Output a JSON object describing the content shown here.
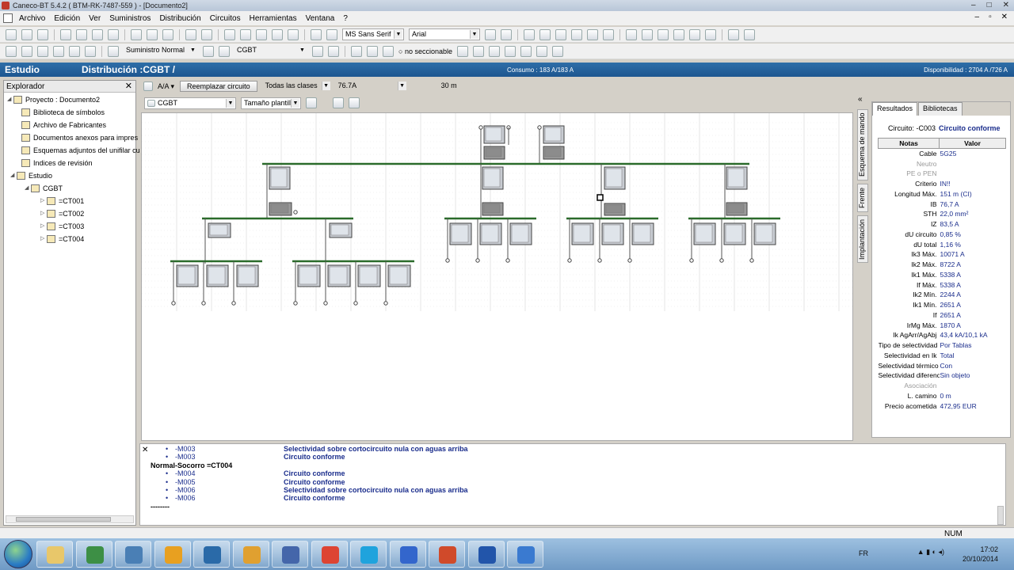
{
  "window": {
    "title": "Caneco-BT 5.4.2 ( BTM-RK-7487-559 ) - [Documento2]"
  },
  "menu": [
    "Archivo",
    "Edición",
    "Ver",
    "Suministros",
    "Distribución",
    "Circuitos",
    "Herramientas",
    "Ventana",
    "?"
  ],
  "toolbar": {
    "font_main": "MS Sans Serif",
    "font_secondary": "Arial",
    "supply_mode": "Suministro Normal",
    "board": "CGBT",
    "sectioning": "no seccionable"
  },
  "header": {
    "left": "Estudio",
    "title": "Distribución :CGBT /",
    "consumption": "Consumo : 183 A/183 A",
    "availability": "Disponibilidad : 2704 A /726 A"
  },
  "explorer": {
    "title": "Explorador",
    "items": [
      {
        "label": "Proyecto : Documento2"
      },
      {
        "label": "Biblioteca de símbolos"
      },
      {
        "label": "Archivo de Fabricantes"
      },
      {
        "label": "Documentos anexos para impres"
      },
      {
        "label": "Esquemas adjuntos del unifilar cu"
      },
      {
        "label": "Indices de revisión"
      },
      {
        "label": "Estudio"
      },
      {
        "label": "CGBT"
      },
      {
        "label": "=CT001"
      },
      {
        "label": "=CT002"
      },
      {
        "label": "=CT003"
      },
      {
        "label": "=CT004"
      }
    ]
  },
  "subbar": {
    "aa": "A/A",
    "replace_button": "Reemplazar circuito",
    "classes": "Todas las clases",
    "current": "76.7A",
    "length": "30 m",
    "view_board": "CGBT",
    "template_size": "Tamaño plantill"
  },
  "side_tabs": [
    "Esquema de mando",
    "Frente",
    "Implantación"
  ],
  "results": {
    "tabs": [
      "Resultados",
      "Bibliotecas"
    ],
    "circuit_label": "Circuito: -C003",
    "circuit_status": "Circuito conforme",
    "col_notes": "Notas",
    "col_value": "Valor",
    "rows": [
      {
        "k": "Cable",
        "v": "5G25"
      },
      {
        "k": "Neutro",
        "v": ""
      },
      {
        "k": "PE o PEN",
        "v": ""
      },
      {
        "k": "Criterio",
        "v": "IN!!"
      },
      {
        "k": "Longitud Máx.",
        "v": "151 m (CI)"
      },
      {
        "k": "IB",
        "v": "76,7 A"
      },
      {
        "k": "STH",
        "v": "22,0 mm²"
      },
      {
        "k": "IZ",
        "v": "83,5 A"
      },
      {
        "k": "dU circuito",
        "v": "0,85 %"
      },
      {
        "k": "dU total",
        "v": "1,16 %"
      },
      {
        "k": "Ik3 Máx.",
        "v": "10071 A"
      },
      {
        "k": "Ik2 Máx.",
        "v": "8722 A"
      },
      {
        "k": "Ik1 Máx.",
        "v": "5338 A"
      },
      {
        "k": "If Máx.",
        "v": "5338 A"
      },
      {
        "k": "Ik2 Mín.",
        "v": "2244 A"
      },
      {
        "k": "Ik1 Mín.",
        "v": "2651 A"
      },
      {
        "k": "If",
        "v": "2651 A"
      },
      {
        "k": "IrMg Máx.",
        "v": "1870 A"
      },
      {
        "k": "Ik AgArr/AgAbj",
        "v": "43,4 kA/10,1 kA"
      },
      {
        "k": "Tipo de selectividad",
        "v": "Por Tablas"
      },
      {
        "k": "Selectividad en Ik",
        "v": "Total"
      },
      {
        "k": "Selectividad térmico",
        "v": "Con"
      },
      {
        "k": "Selectividad diferencial",
        "v": "Sin objeto"
      },
      {
        "k": "Asociación",
        "v": ""
      },
      {
        "k": "L. camino",
        "v": "0 m"
      },
      {
        "k": "Precio acometida",
        "v": "472,95 EUR"
      }
    ]
  },
  "messages": [
    {
      "bullet": "•",
      "code": "-M003",
      "text": "Selectividad sobre cortocircuito nula con aguas arriba"
    },
    {
      "bullet": "•",
      "code": "-M003",
      "text": "Circuito conforme"
    },
    {
      "header": "Normal-Socorro =CT004"
    },
    {
      "bullet": "•",
      "code": "-M004",
      "text": "Circuito conforme"
    },
    {
      "bullet": "•",
      "code": "-M005",
      "text": "Circuito conforme"
    },
    {
      "bullet": "•",
      "code": "-M006",
      "text": "Selectividad sobre cortocircuito nula con aguas arriba"
    },
    {
      "bullet": "•",
      "code": "-M006",
      "text": "Circuito conforme"
    },
    {
      "header": "--------"
    }
  ],
  "status": {
    "num": "NUM"
  },
  "taskbar": {
    "lang": "FR",
    "time": "17:02",
    "date": "20/10/2014",
    "apps": [
      "explorer",
      "excel-chart",
      "wifi-app",
      "flower-app",
      "bird-app",
      "outlook",
      "network-app",
      "chrome",
      "skype",
      "snowflake-app",
      "powerpoint",
      "caneco-bt",
      "security"
    ]
  }
}
